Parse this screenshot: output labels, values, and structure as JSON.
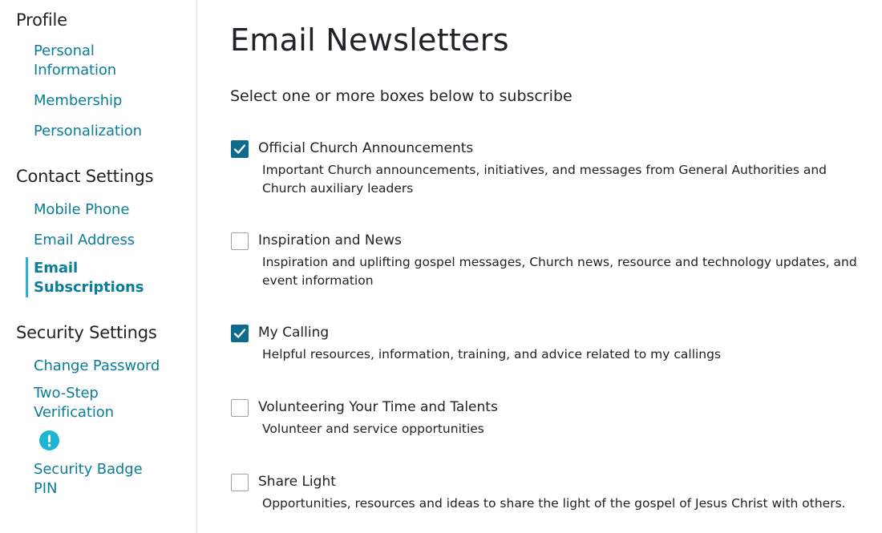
{
  "sidebar": {
    "sections": [
      {
        "heading": "Profile",
        "items": [
          {
            "label": "Personal Information"
          },
          {
            "label": "Membership"
          },
          {
            "label": "Personalization"
          }
        ]
      },
      {
        "heading": "Contact Settings",
        "items": [
          {
            "label": "Mobile Phone"
          },
          {
            "label": "Email Address"
          },
          {
            "label": "Email Subscriptions",
            "active": true
          }
        ]
      },
      {
        "heading": "Security Settings",
        "items": [
          {
            "label": "Change Password"
          },
          {
            "label": "Two-Step Verification",
            "icon": "alert-icon"
          },
          {
            "label": "Security Badge PIN"
          }
        ]
      }
    ]
  },
  "main": {
    "title": "Email Newsletters",
    "instructions": "Select one or more boxes below to subscribe",
    "options": [
      {
        "label": "Official Church Announcements",
        "description": "Important Church announcements, initiatives, and messages from General Authorities and Church auxiliary leaders",
        "checked": true
      },
      {
        "label": "Inspiration and News",
        "description": "Inspiration and uplifting gospel messages, Church news, resource and technology updates, and event information",
        "checked": false
      },
      {
        "label": "My Calling",
        "description": "Helpful resources, information, training, and advice related to my callings",
        "checked": true
      },
      {
        "label": "Volunteering Your Time and Talents",
        "description": "Volunteer and service opportunities",
        "checked": false
      },
      {
        "label": "Share Light",
        "description": "Opportunities, resources and ideas to share the light of the gospel of Jesus Christ with others.",
        "checked": false
      }
    ]
  },
  "colors": {
    "link": "#0a7d9a",
    "active_bar": "#2bb2d3",
    "checkbox_checked": "#0f6b8c",
    "alert": "#1eb4d4"
  }
}
